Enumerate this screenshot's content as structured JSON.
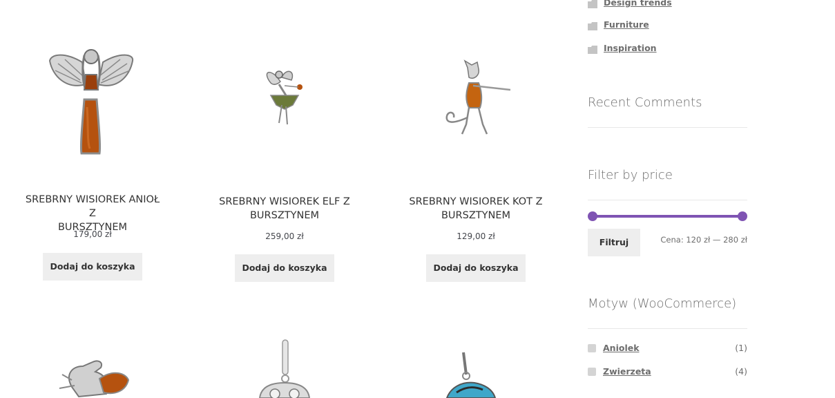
{
  "products": [
    {
      "title_line1": "SREBRNY WISIOREK ANIOŁ Z",
      "title_line2": "BURSZTYNEM",
      "price": "179,00 zł",
      "button": "Dodaj do koszyka",
      "image": "angel-pendant"
    },
    {
      "title_line1": "SREBRNY WISIOREK ELF Z",
      "title_line2": "BURSZTYNEM",
      "price": "259,00 zł",
      "button": "Dodaj do koszyka",
      "image": "elf-pendant"
    },
    {
      "title_line1": "SREBRNY WISIOREK KOT Z",
      "title_line2": "BURSZTYNEM",
      "price": "129,00 zł",
      "button": "Dodaj do koszyka",
      "image": "cat-pendant"
    },
    {
      "image": "pegasus-pendant"
    },
    {
      "image": "owl-pendant"
    },
    {
      "image": "dolphin-pendant"
    }
  ],
  "sidebar": {
    "categories": [
      {
        "label": "Design trends",
        "icon": "folder-icon"
      },
      {
        "label": "Furniture",
        "icon": "folder-icon"
      },
      {
        "label": "Inspiration",
        "icon": "folder-icon"
      }
    ],
    "recent_comments_title": "Recent Comments",
    "filter_title": "Filter by price",
    "filter_button": "Filtruj",
    "price_range": "Cena: 120 zł — 280 zł",
    "price_range_min_fraction": 0,
    "price_range_max_fraction": 1,
    "attribute_title": "Motyw (WooCommerce)",
    "attributes": [
      {
        "label": "Aniolek",
        "count": "(1)"
      },
      {
        "label": "Zwierzeta",
        "count": "(4)"
      }
    ]
  },
  "colors": {
    "accent": "#7f54b3",
    "button_bg": "#eeeeee",
    "amber": "#b5520f"
  }
}
